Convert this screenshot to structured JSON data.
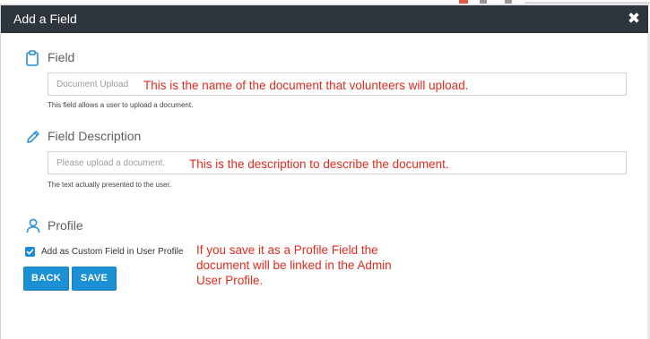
{
  "dialog": {
    "title": "Add a Field",
    "close_icon": "close-icon",
    "header_color": "#2f353d"
  },
  "sections": {
    "field": {
      "icon": "clipboard-icon",
      "label": "Field",
      "input_placeholder": "Document Upload",
      "help_text": "This field allows a user to upload a document.",
      "annotation": "This is the name of the document that volunteers will upload."
    },
    "description": {
      "icon": "pencil-icon",
      "label": "Field Description",
      "input_placeholder": "Please upload a document.",
      "help_text": "The text actually presented to the user.",
      "annotation": "This is the description to describe the document."
    },
    "profile": {
      "icon": "user-icon",
      "label": "Profile",
      "checkbox_label": "Add as Custom Field in User Profile",
      "checkbox_checked": true,
      "annotation_lines": [
        "If you save it as a Profile Field the",
        "document will be linked in the Admin",
        "User Profile."
      ]
    }
  },
  "buttons": {
    "back_label": "BACK",
    "save_label": "SAVE"
  },
  "colors": {
    "accent": "#1b90d4",
    "icon": "#2a8fd6",
    "annotation": "#e12b1e"
  }
}
